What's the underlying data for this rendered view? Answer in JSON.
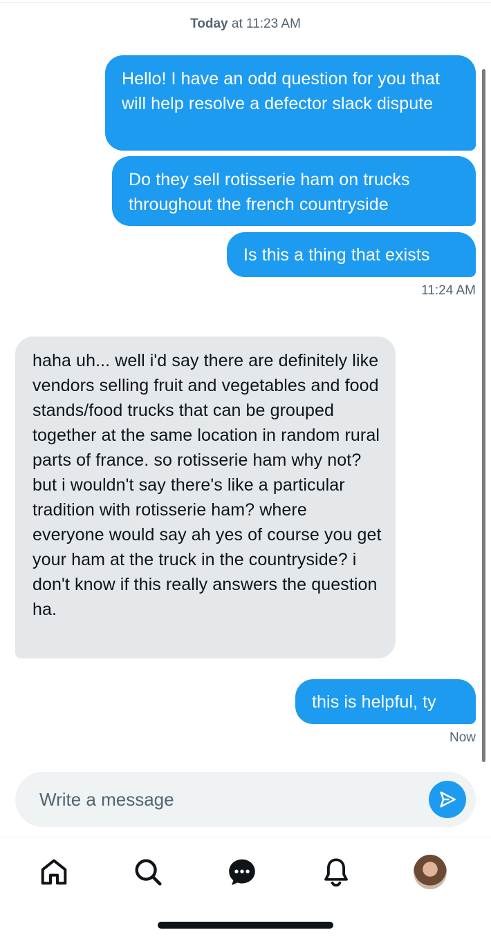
{
  "conversation": {
    "date_header": {
      "day": "Today",
      "rest": "at 11:23 AM"
    },
    "messages": [
      {
        "direction": "outgoing",
        "text": "Hello! I have an odd question for you that will help resolve a defector slack dispute"
      },
      {
        "direction": "outgoing",
        "text": "Do they sell rotisserie ham on trucks throughout the french countryside"
      },
      {
        "direction": "outgoing",
        "text": "Is this a thing that exists",
        "time": "11:24 AM"
      },
      {
        "direction": "incoming",
        "text": "haha uh... well i'd say there are definitely like vendors selling fruit and vegetables and food stands/food trucks that can be grouped together at the same location in random rural parts of france. so rotisserie ham why not? but i wouldn't say there's like a particular tradition with rotisserie ham? where everyone would say ah yes of course you get your ham at the truck in the countryside? i don't know if this really answers the question ha."
      },
      {
        "direction": "outgoing",
        "text": "this is helpful, ty",
        "time": "Now"
      }
    ]
  },
  "composer": {
    "placeholder": "Write a message",
    "value": "",
    "send_icon": "send-icon"
  },
  "bottom_nav": {
    "items": [
      {
        "icon": "home-icon"
      },
      {
        "icon": "search-icon"
      },
      {
        "icon": "messages-icon",
        "active": true
      },
      {
        "icon": "bell-icon"
      },
      {
        "icon": "profile-avatar"
      }
    ]
  },
  "colors": {
    "accent": "#1d9bf0",
    "incoming_bubble": "#e4e8eb",
    "text_primary": "#0f1419",
    "text_secondary": "#536471",
    "composer_bg": "#eff3f4"
  }
}
